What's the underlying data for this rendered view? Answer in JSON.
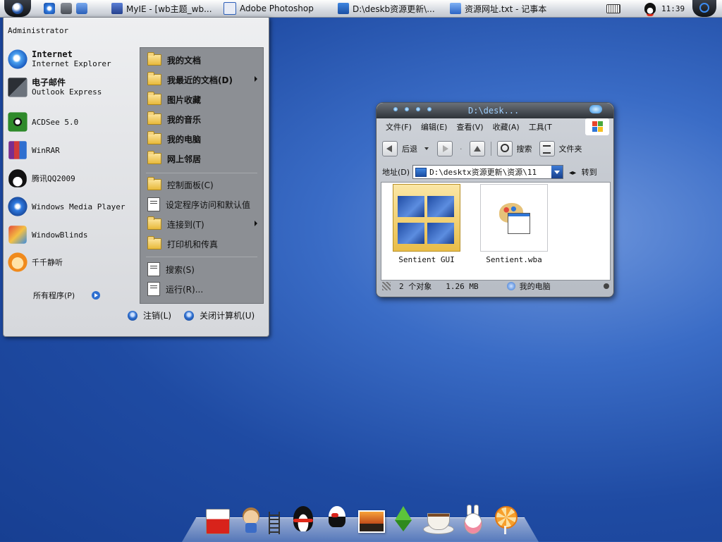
{
  "taskbar": {
    "tasks": [
      {
        "label": "MyIE - [wb主题_wb...",
        "icon": "myie-icon"
      },
      {
        "label": "Adobe Photoshop",
        "icon": "photoshop-icon"
      },
      {
        "label": "D:\\deskb资源更新\\...",
        "icon": "folder-window-icon"
      },
      {
        "label": "资源网址.txt - 记事本",
        "icon": "notepad-icon"
      }
    ],
    "clock": "11:39",
    "colors": {
      "accent": "#2e6fd0",
      "bar": "#d9dde3"
    }
  },
  "start_menu": {
    "user": "Administrator",
    "pinned": [
      {
        "title": "Internet",
        "subtitle": "Internet Explorer",
        "icon": "ie-icon"
      },
      {
        "title": "电子邮件",
        "subtitle": "Outlook Express",
        "icon": "outlook-icon"
      }
    ],
    "recent": [
      {
        "label": "ACDSee 5.0",
        "icon": "acdsee-icon"
      },
      {
        "label": "WinRAR",
        "icon": "winrar-icon"
      },
      {
        "label": "腾讯QQ2009",
        "icon": "qq-icon"
      },
      {
        "label": "Windows Media Player",
        "icon": "media-player-icon"
      },
      {
        "label": "WindowBlinds",
        "icon": "windowblinds-icon"
      },
      {
        "label": "千千静听",
        "icon": "ttplayer-icon"
      }
    ],
    "all_programs": "所有程序(P)",
    "places": [
      {
        "label": "我的文档",
        "icon": "folder-icon",
        "submenu": false
      },
      {
        "label": "我最近的文档(D)",
        "icon": "folder-icon",
        "submenu": true
      },
      {
        "label": "图片收藏",
        "icon": "folder-icon",
        "submenu": false
      },
      {
        "label": "我的音乐",
        "icon": "folder-icon",
        "submenu": false
      },
      {
        "label": "我的电脑",
        "icon": "folder-icon",
        "submenu": false
      },
      {
        "label": "网上邻居",
        "icon": "folder-icon",
        "submenu": false
      }
    ],
    "settings": [
      {
        "label": "控制面板(C)",
        "icon": "folder-icon",
        "submenu": false
      },
      {
        "label": "设定程序访问和默认值",
        "icon": "document-icon",
        "submenu": false
      },
      {
        "label": "连接到(T)",
        "icon": "folder-icon",
        "submenu": true
      },
      {
        "label": "打印机和传真",
        "icon": "folder-icon",
        "submenu": false
      }
    ],
    "tools": [
      {
        "label": "搜索(S)",
        "icon": "document-icon"
      },
      {
        "label": "运行(R)...",
        "icon": "document-icon"
      }
    ],
    "logoff": "注销(L)",
    "shutdown": "关闭计算机(U)"
  },
  "explorer": {
    "title": "D:\\desk...",
    "menu": [
      "文件(F)",
      "编辑(E)",
      "查看(V)",
      "收藏(A)",
      "工具(T"
    ],
    "toolbar": {
      "back": "后退",
      "search": "搜索",
      "folders": "文件夹"
    },
    "address_label": "地址(D)",
    "address": "D:\\desktx资源更新\\资源\\11",
    "go": "转到",
    "files": [
      {
        "name": "Sentient GUI",
        "icon": "folder-thumbnail-icon"
      },
      {
        "name": "Sentient.wba",
        "icon": "windowblinds-file-icon"
      }
    ],
    "status": {
      "count": "2 个对象",
      "size": "1.26 MB",
      "location": "我的电脑"
    }
  },
  "dock": {
    "items": [
      "milk-carton-icon",
      "pirate-icon",
      "ladder-icon",
      "qq-penguin-icon",
      "bird-icon",
      "photo-icon",
      "sketchup-icon",
      "coffee-cup-icon",
      "rabbit-icon",
      "lollipop-icon"
    ]
  }
}
